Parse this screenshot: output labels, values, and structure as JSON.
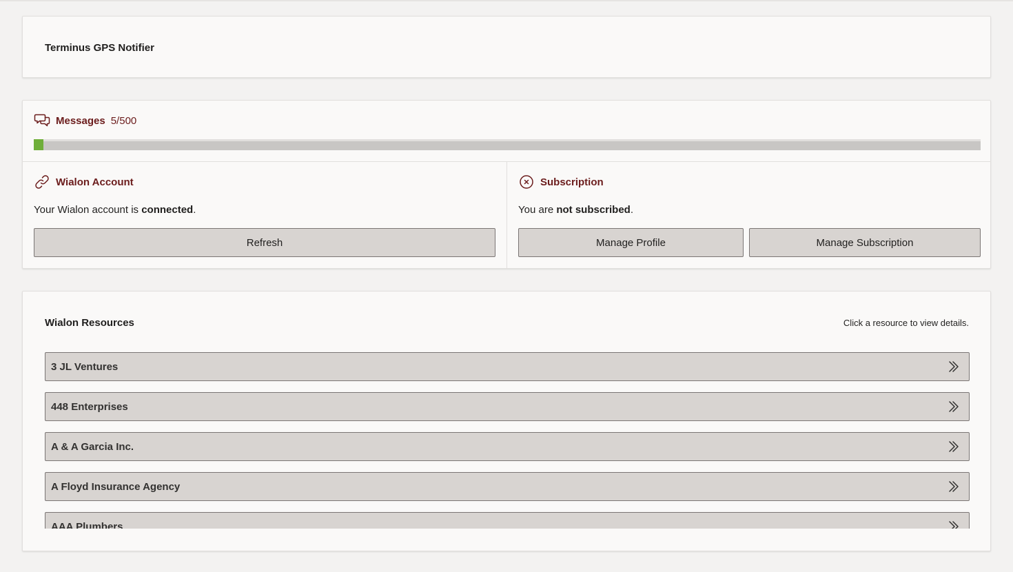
{
  "app": {
    "title": "Terminus GPS Notifier"
  },
  "messages": {
    "icon": "chat-bubbles-icon",
    "label": "Messages",
    "count_text": "5/500",
    "used": 5,
    "limit": 500,
    "progress_fraction": 0.01,
    "colors": {
      "fill": "#6fae3a",
      "track": "#c8c6c4"
    }
  },
  "wialon_account": {
    "icon": "link-icon",
    "label": "Wialon Account",
    "status_prefix": "Your Wialon account is ",
    "status_value": "connected",
    "status_suffix": ".",
    "refresh_button": "Refresh"
  },
  "subscription": {
    "icon": "circle-x-icon",
    "label": "Subscription",
    "status_prefix": "You are ",
    "status_value": "not subscribed",
    "status_suffix": ".",
    "manage_profile_button": "Manage Profile",
    "manage_subscription_button": "Manage Subscription"
  },
  "resources": {
    "title": "Wialon Resources",
    "hint": "Click a resource to view details.",
    "chevron_icon": "double-chevron-right-icon",
    "items": [
      {
        "name": "3 JL Ventures"
      },
      {
        "name": "448 Enterprises"
      },
      {
        "name": "A & A Garcia Inc."
      },
      {
        "name": "A Floyd Insurance Agency"
      },
      {
        "name": "AAA Plumbers"
      }
    ]
  },
  "colors": {
    "accent": "#6b1c1c",
    "page_background": "#f3f2f1",
    "card_background": "#faf9f8",
    "button_background": "#d8d4d1",
    "button_border": "#7a7574"
  }
}
